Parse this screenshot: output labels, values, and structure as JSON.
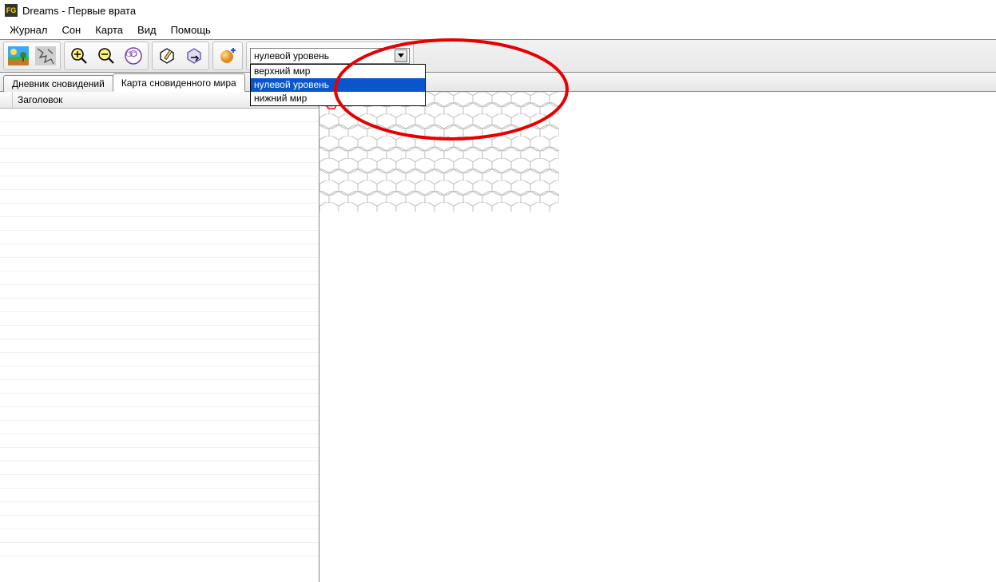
{
  "title": "Dreams - Первые врата",
  "menu": {
    "journal": "Журнал",
    "sleep": "Сон",
    "map": "Карта",
    "view": "Вид",
    "help": "Помощь"
  },
  "tabs": {
    "diary": "Дневник сновидений",
    "map": "Карта сновиденного мира"
  },
  "list": {
    "header": "Заголовок"
  },
  "combo": {
    "selected": "нулевой уровень",
    "options": [
      "верхний мир",
      "нулевой уровень",
      "нижний мир"
    ]
  }
}
